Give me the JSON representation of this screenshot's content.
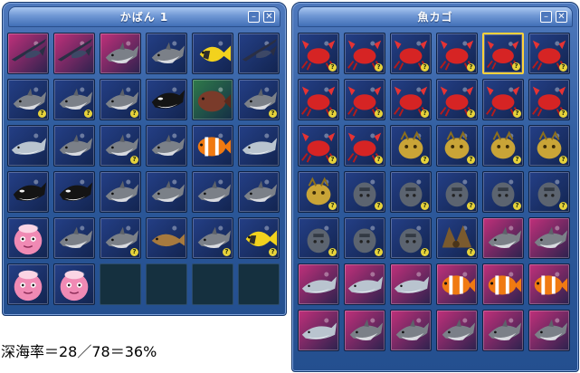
{
  "bag_window": {
    "title": "かばん 1",
    "slots": [
      {
        "item": "marlin",
        "bg": "pink",
        "badge": false
      },
      {
        "item": "marlin",
        "bg": "pink",
        "badge": false
      },
      {
        "item": "shark",
        "bg": "pink",
        "badge": false
      },
      {
        "item": "shark",
        "bg": "blue",
        "badge": false
      },
      {
        "item": "tropical-fish",
        "bg": "blue",
        "badge": false
      },
      {
        "item": "marlin",
        "bg": "blue",
        "badge": false
      },
      {
        "item": "shark",
        "bg": "blue",
        "badge": true
      },
      {
        "item": "shark",
        "bg": "blue",
        "badge": true
      },
      {
        "item": "shark",
        "bg": "blue",
        "badge": true
      },
      {
        "item": "orca",
        "bg": "blue",
        "badge": false
      },
      {
        "item": "grouper",
        "bg": "green",
        "badge": false
      },
      {
        "item": "shark",
        "bg": "blue",
        "badge": true
      },
      {
        "item": "dolphin",
        "bg": "blue",
        "badge": false
      },
      {
        "item": "shark",
        "bg": "blue",
        "badge": false
      },
      {
        "item": "shark",
        "bg": "blue",
        "badge": true
      },
      {
        "item": "shark",
        "bg": "blue",
        "badge": false
      },
      {
        "item": "clownfish",
        "bg": "blue",
        "badge": false
      },
      {
        "item": "dolphin",
        "bg": "blue",
        "badge": false
      },
      {
        "item": "orca",
        "bg": "blue",
        "badge": false
      },
      {
        "item": "orca",
        "bg": "blue",
        "badge": false
      },
      {
        "item": "shark",
        "bg": "blue",
        "badge": false
      },
      {
        "item": "shark",
        "bg": "blue",
        "badge": false
      },
      {
        "item": "shark",
        "bg": "blue",
        "badge": false
      },
      {
        "item": "shark",
        "bg": "blue",
        "badge": false
      },
      {
        "item": "pink-blob",
        "bg": "blue",
        "badge": false
      },
      {
        "item": "shark",
        "bg": "blue",
        "badge": false
      },
      {
        "item": "shark",
        "bg": "blue",
        "badge": true
      },
      {
        "item": "fish",
        "bg": "blue",
        "badge": false
      },
      {
        "item": "shark",
        "bg": "blue",
        "badge": true
      },
      {
        "item": "tropical-fish",
        "bg": "blue",
        "badge": true
      },
      {
        "item": "pink-blob",
        "bg": "blue",
        "badge": false
      },
      {
        "item": "pink-blob",
        "bg": "blue",
        "badge": false
      },
      {
        "item": "empty"
      },
      {
        "item": "empty"
      },
      {
        "item": "empty"
      },
      {
        "item": "empty"
      }
    ]
  },
  "fish_basket_window": {
    "title": "魚カゴ",
    "slots": [
      {
        "item": "crab",
        "bg": "blue",
        "badge": true
      },
      {
        "item": "crab",
        "bg": "blue",
        "badge": true
      },
      {
        "item": "crab",
        "bg": "blue",
        "badge": true
      },
      {
        "item": "crab",
        "bg": "blue",
        "badge": true
      },
      {
        "item": "crab",
        "bg": "blue",
        "badge": true,
        "selected": true
      },
      {
        "item": "crab",
        "bg": "blue",
        "badge": true
      },
      {
        "item": "crab",
        "bg": "blue",
        "badge": true
      },
      {
        "item": "crab",
        "bg": "blue",
        "badge": true
      },
      {
        "item": "crab",
        "bg": "blue",
        "badge": true
      },
      {
        "item": "crab",
        "bg": "blue",
        "badge": true
      },
      {
        "item": "crab",
        "bg": "blue",
        "badge": true
      },
      {
        "item": "crab",
        "bg": "blue",
        "badge": true
      },
      {
        "item": "crab",
        "bg": "blue",
        "badge": true
      },
      {
        "item": "crab",
        "bg": "blue",
        "badge": true
      },
      {
        "item": "golden-creature",
        "bg": "blue",
        "badge": true
      },
      {
        "item": "golden-creature",
        "bg": "blue",
        "badge": true
      },
      {
        "item": "golden-creature",
        "bg": "blue",
        "badge": true
      },
      {
        "item": "golden-creature",
        "bg": "blue",
        "badge": true
      },
      {
        "item": "golden-creature",
        "bg": "blue",
        "badge": true
      },
      {
        "item": "stone-creature",
        "bg": "blue",
        "badge": true
      },
      {
        "item": "stone-creature",
        "bg": "blue",
        "badge": true
      },
      {
        "item": "stone-creature",
        "bg": "blue",
        "badge": true
      },
      {
        "item": "stone-creature",
        "bg": "blue",
        "badge": true
      },
      {
        "item": "stone-creature",
        "bg": "blue",
        "badge": true
      },
      {
        "item": "stone-creature",
        "bg": "blue",
        "badge": true
      },
      {
        "item": "stone-creature",
        "bg": "blue",
        "badge": true
      },
      {
        "item": "stone-creature",
        "bg": "blue",
        "badge": true
      },
      {
        "item": "brown-creature",
        "bg": "blue",
        "badge": true
      },
      {
        "item": "shark",
        "bg": "pink",
        "badge": false
      },
      {
        "item": "shark",
        "bg": "pink",
        "badge": false
      },
      {
        "item": "dolphin",
        "bg": "pink",
        "badge": false
      },
      {
        "item": "dolphin",
        "bg": "pink",
        "badge": false
      },
      {
        "item": "dolphin",
        "bg": "pink",
        "badge": false
      },
      {
        "item": "clownfish",
        "bg": "pink",
        "badge": false
      },
      {
        "item": "clownfish",
        "bg": "pink",
        "badge": false
      },
      {
        "item": "clownfish",
        "bg": "pink",
        "badge": false
      },
      {
        "item": "dolphin",
        "bg": "pink",
        "badge": false
      },
      {
        "item": "shark",
        "bg": "pink",
        "badge": false
      },
      {
        "item": "shark",
        "bg": "pink",
        "badge": false
      },
      {
        "item": "shark",
        "bg": "pink",
        "badge": false
      },
      {
        "item": "shark",
        "bg": "pink",
        "badge": false
      },
      {
        "item": "shark",
        "bg": "pink",
        "badge": false
      }
    ]
  },
  "window_controls": {
    "minimize_glyph": "–",
    "close_glyph": "✕"
  },
  "badge_glyph": "?",
  "deep_sea_rate": "深海率＝28／78＝36%",
  "colors": {
    "bg_blue": "#243f86",
    "bg_pink": "#c0307a",
    "bg_green": "#2f7a4a",
    "selected_border": "#ffd23a",
    "badge": "#e6d23a"
  }
}
